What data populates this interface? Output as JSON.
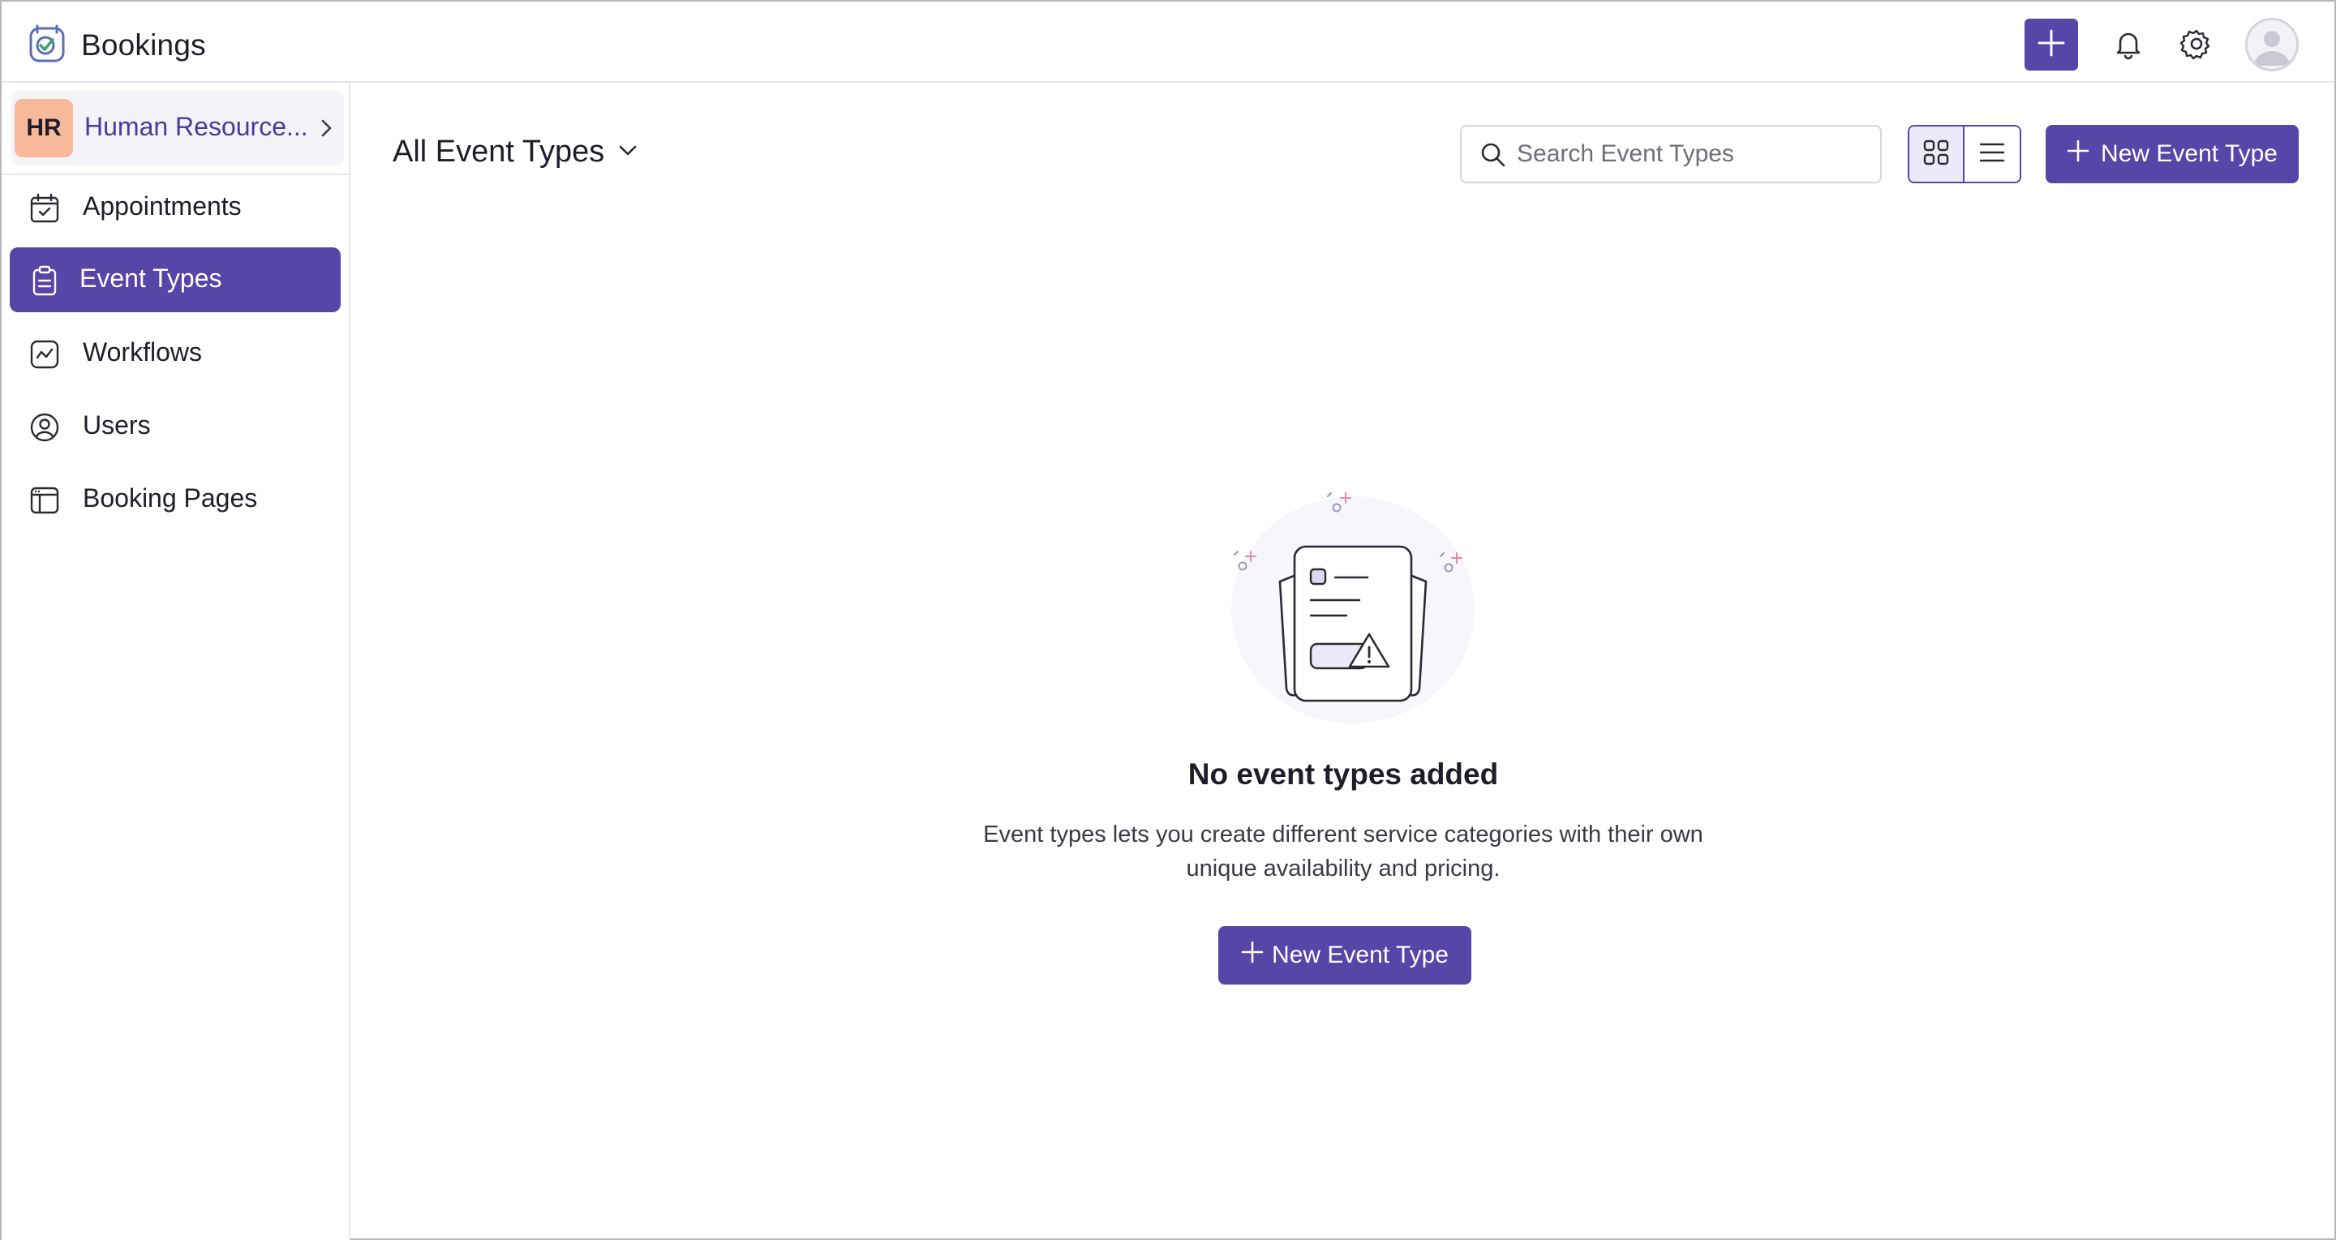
{
  "app": {
    "name": "Bookings",
    "logo_icon": "calendar-check-logo-icon"
  },
  "topbar": {
    "add_icon": "plus-icon",
    "bell_icon": "bell-icon",
    "settings_icon": "gear-icon",
    "avatar_icon": "user-avatar-icon"
  },
  "sidebar": {
    "org": {
      "initials": "HR",
      "name": "Human Resource...",
      "badge_color": "#f7b99a"
    },
    "items": [
      {
        "label": "Appointments",
        "icon": "calendar-check-icon",
        "active": false
      },
      {
        "label": "Event Types",
        "icon": "clipboard-icon",
        "active": true
      },
      {
        "label": "Workflows",
        "icon": "workflow-icon",
        "active": false
      },
      {
        "label": "Users",
        "icon": "user-circle-icon",
        "active": false
      },
      {
        "label": "Booking Pages",
        "icon": "booking-page-icon",
        "active": false
      }
    ]
  },
  "main": {
    "filter_label": "All Event Types",
    "search_placeholder": "Search Event Types",
    "search_value": "",
    "view_mode": "grid",
    "new_button_label": "New Event Type"
  },
  "empty_state": {
    "title": "No event types added",
    "description": "Event types lets you create different service categories with their own unique availability and pricing.",
    "button_label": "New Event Type"
  },
  "colors": {
    "accent": "#5745a8",
    "accent_light": "#ece9f8",
    "org_text": "#4b3a9c"
  }
}
